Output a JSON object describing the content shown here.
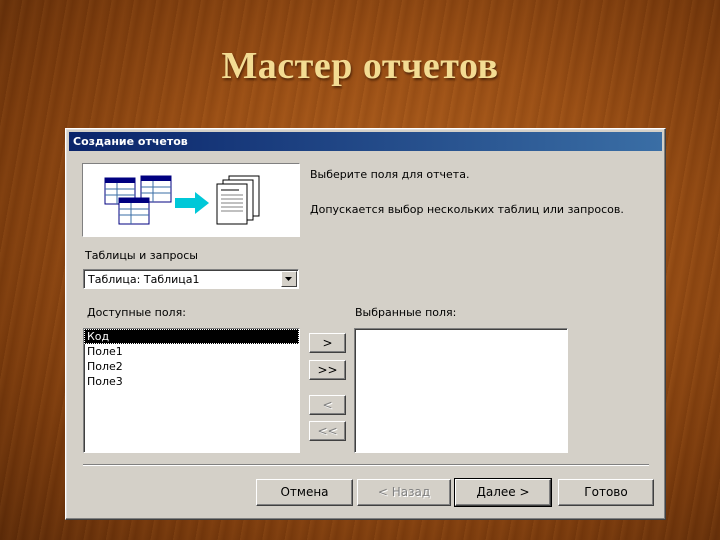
{
  "slide": {
    "title": "Мастер отчетов"
  },
  "window": {
    "title": "Создание отчетов"
  },
  "illustration": {
    "icon": "report-wizard-illustration"
  },
  "description": {
    "line1": "Выберите поля для отчета.",
    "line2": "Допускается выбор нескольких таблиц или запросов."
  },
  "source": {
    "label": "Таблицы и запросы",
    "value": "Таблица: Таблица1"
  },
  "available": {
    "label": "Доступные поля:",
    "items": [
      "Код",
      "Поле1",
      "Поле2",
      "Поле3"
    ],
    "selected_index": 0
  },
  "selected": {
    "label": "Выбранные поля:",
    "items": []
  },
  "transfer": {
    "add_one": ">",
    "add_all": ">>",
    "remove_one": "<",
    "remove_all": "<<"
  },
  "footer": {
    "cancel": "Отмена",
    "back": "< Назад",
    "next": "Далее >",
    "finish": "Готово"
  },
  "colors": {
    "titlebar": "#0a246a",
    "dialog_face": "#d4d0c8",
    "slide_title": "#f3dc93"
  }
}
